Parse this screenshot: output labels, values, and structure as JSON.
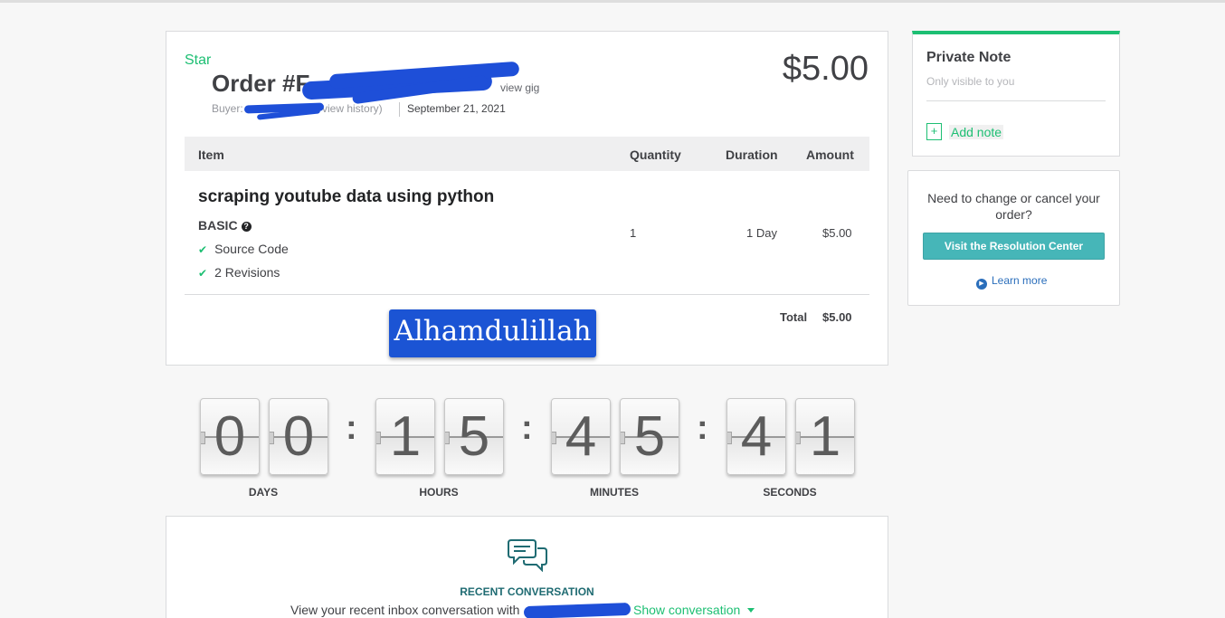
{
  "order": {
    "star_label": "Star",
    "title_prefix": "Order #F",
    "view_gig": "view gig",
    "buyer_label": "Buyer:",
    "view_history": "view history)",
    "date": "September 21, 2021",
    "price": "$5.00",
    "columns": {
      "item": "Item",
      "quantity": "Quantity",
      "duration": "Duration",
      "amount": "Amount"
    },
    "item": {
      "title": "scraping youtube data using python",
      "package": "BASIC",
      "features": [
        "Source Code",
        "2 Revisions"
      ],
      "quantity": "1",
      "duration": "1 Day",
      "amount": "$5.00"
    },
    "total_label": "Total",
    "total_value": "$5.00",
    "stamp_text": "Alhamdulillah"
  },
  "private_note": {
    "title": "Private Note",
    "subtitle": "Only visible to you",
    "add_note": "Add note"
  },
  "resolution": {
    "text": "Need to change or cancel your order?",
    "button": "Visit the Resolution Center",
    "learn_more": "Learn more"
  },
  "countdown": {
    "days": [
      "0",
      "0"
    ],
    "hours": [
      "1",
      "5"
    ],
    "minutes": [
      "4",
      "5"
    ],
    "seconds": [
      "4",
      "1"
    ],
    "separator": ":",
    "labels": {
      "days": "DAYS",
      "hours": "HOURS",
      "minutes": "MINUTES",
      "seconds": "SECONDS"
    }
  },
  "conversation": {
    "title": "RECENT CONVERSATION",
    "text": "View your recent inbox conversation with",
    "show": "Show conversation"
  },
  "colors": {
    "accent_green": "#1dbf73",
    "redaction_blue": "#1e4fd8",
    "resolution_teal": "#46b6b8",
    "link_blue": "#2a6ebb"
  },
  "icons": {
    "help": "question-circle-icon",
    "check": "check-icon",
    "add_note": "add-note-icon",
    "play": "play-circle-icon",
    "chat": "chat-bubbles-icon",
    "caret": "caret-down-icon"
  }
}
